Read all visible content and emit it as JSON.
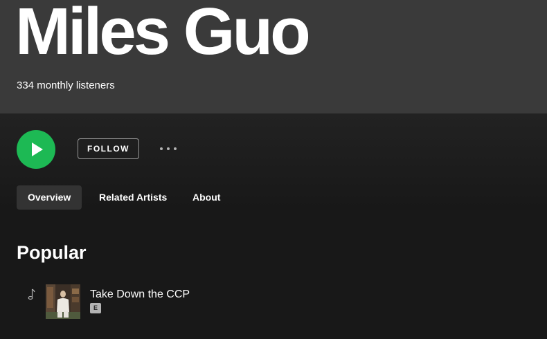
{
  "artist": {
    "name": "Miles Guo",
    "monthly_listeners": "334 monthly listeners"
  },
  "actions": {
    "play_icon": "play-icon",
    "follow_label": "FOLLOW",
    "more_icon": "more-horizontal-icon"
  },
  "tabs": [
    {
      "label": "Overview",
      "active": true
    },
    {
      "label": "Related Artists",
      "active": false
    },
    {
      "label": "About",
      "active": false
    }
  ],
  "popular": {
    "title": "Popular",
    "tracks": [
      {
        "title": "Take Down the CCP",
        "explicit_badge": "E",
        "status_icon": "music-note-icon"
      }
    ]
  },
  "colors": {
    "header_bg": "#3a3a3a",
    "page_bg": "#181818",
    "accent_green": "#1db954",
    "active_tab_bg": "#333333"
  }
}
